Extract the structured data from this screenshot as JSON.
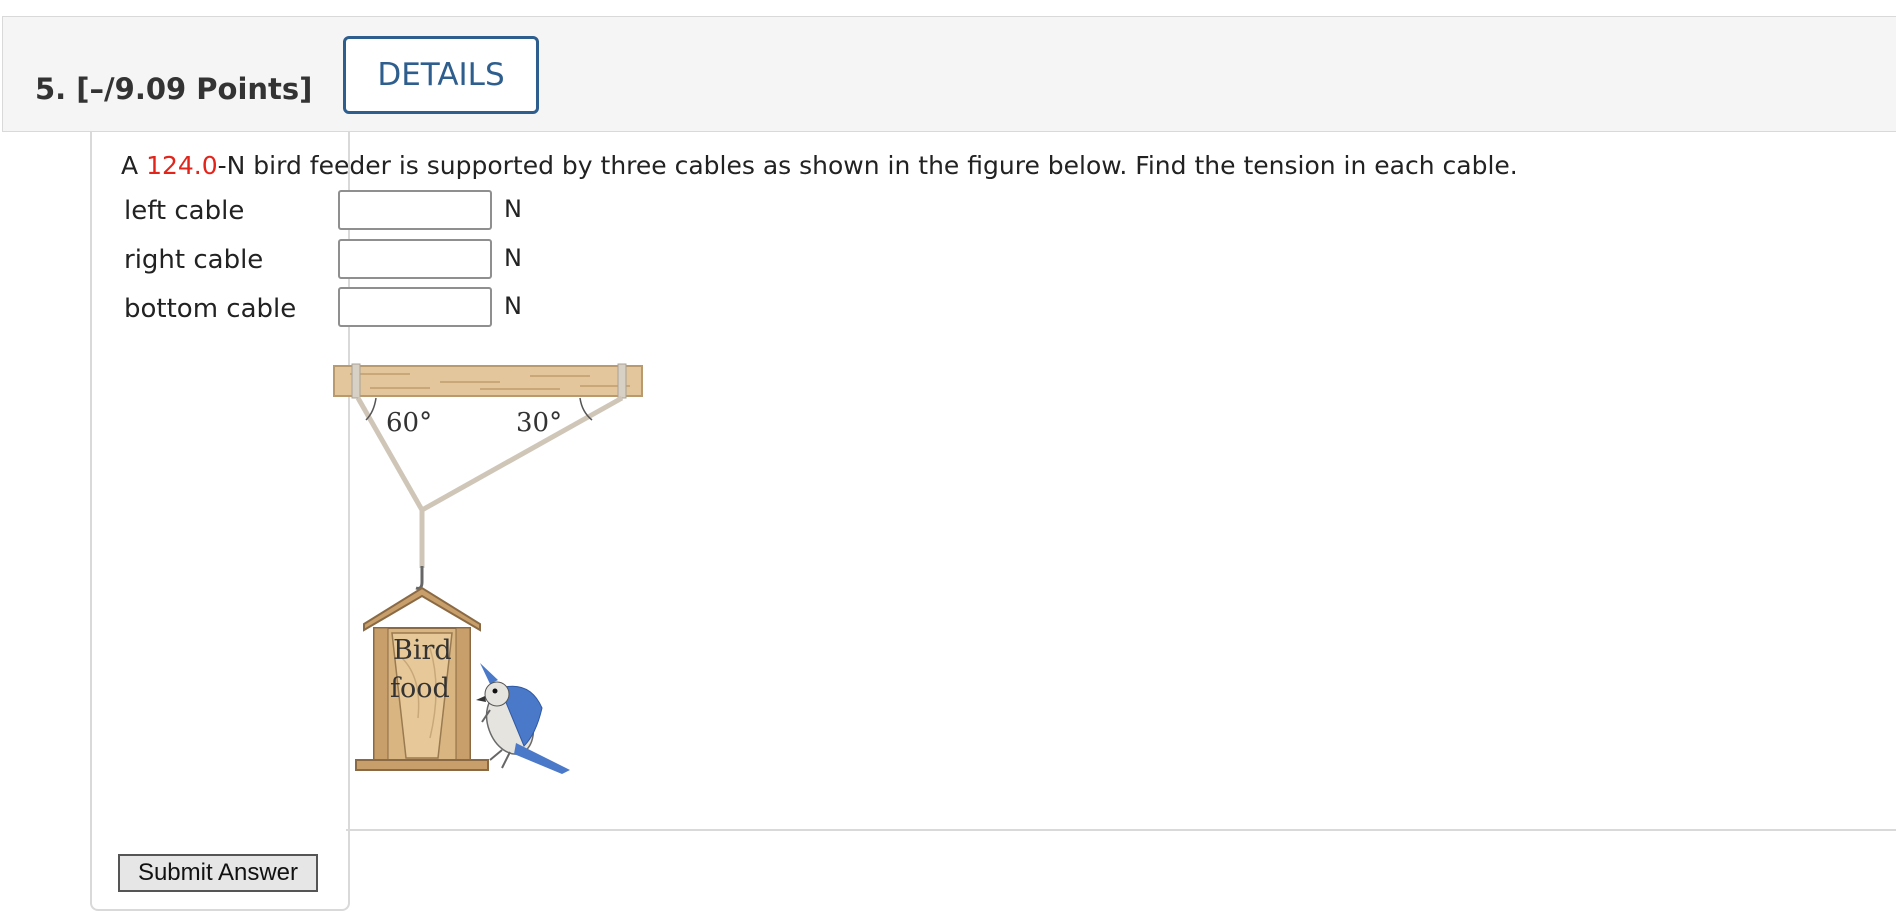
{
  "question": {
    "number_points": "5.  [–/9.09 Points]",
    "details_label": "DETAILS",
    "prompt_before": "A ",
    "prompt_value": "124.0",
    "prompt_after": "-N bird feeder is supported by three cables as shown in the figure below. Find the tension in each cable."
  },
  "inputs": [
    {
      "label": "left cable",
      "unit": "N",
      "value": ""
    },
    {
      "label": "right cable",
      "unit": "N",
      "value": ""
    },
    {
      "label": "bottom cable",
      "unit": "N",
      "value": ""
    }
  ],
  "figure": {
    "left_angle": "60°",
    "right_angle": "30°",
    "sign_line1": "Bird",
    "sign_line2": "food"
  },
  "submit_label": "Submit Answer",
  "colors": {
    "accent": "#2e5e8e",
    "given_value": "#e3241b",
    "wood": "#e3c69c"
  }
}
